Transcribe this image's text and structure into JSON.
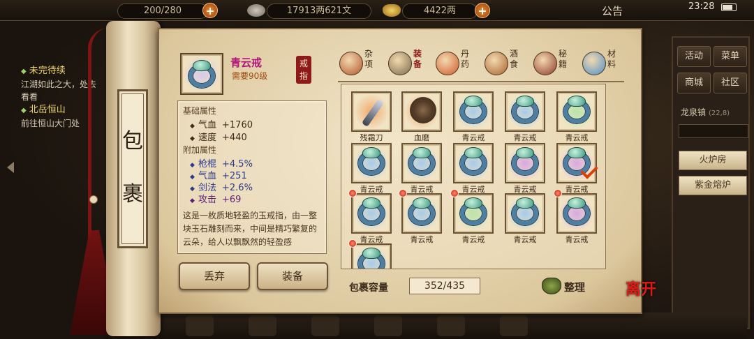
{
  "topbar": {
    "stamina_text": "200/280",
    "copper_text": "17913两621文",
    "silver_text": "4422两",
    "notice_label": "公告",
    "clock": "23:28"
  },
  "quest": {
    "q1_title": "未完待续",
    "q1_desc": "江湖如此之大，处去看看",
    "q2_title": "北岳恒山",
    "q2_desc": "前往恒山大门处"
  },
  "right_menu": {
    "btn_activity": "活动",
    "btn_menu": "菜单",
    "btn_shop": "商城",
    "btn_community": "社区",
    "location": "龙泉镇",
    "coord": "(22,8)",
    "btn_fire_house": "火炉房",
    "btn_purple_furnace": "紫金熔炉"
  },
  "scroll": {
    "ch1": "包",
    "ch2": "裹"
  },
  "selected_item": {
    "name": "青云戒",
    "requirement": "需要90级",
    "type_tag": "戒指",
    "base_title": "基础属性",
    "base_attrs": [
      {
        "name": "气血",
        "value": "+1760"
      },
      {
        "name": "速度",
        "value": "+440"
      }
    ],
    "extra_title": "附加属性",
    "extra_attrs": [
      {
        "name": "枪棍",
        "value": "+4.5%"
      },
      {
        "name": "气血",
        "value": "+251"
      },
      {
        "name": "剑法",
        "value": "+2.6%"
      },
      {
        "name": "攻击",
        "value": "+69"
      }
    ],
    "description": "这是一枚质地轻盈的玉戒指，由一整块玉石雕刻而来，中间是精巧繁复的云朵，给人以飘飘然的轻盈感"
  },
  "actions": {
    "discard": "丢弃",
    "equip": "装备"
  },
  "tabs": [
    {
      "label": "杂项",
      "icon": "jar-icon",
      "color": "#b3552a"
    },
    {
      "label": "装备",
      "icon": "weapons-icon",
      "color": "#7a6a4a"
    },
    {
      "label": "丹药",
      "icon": "pills-icon",
      "color": "#d05a2a"
    },
    {
      "label": "酒食",
      "icon": "wine-food-icon",
      "color": "#a8642c"
    },
    {
      "label": "秘籍",
      "icon": "books-icon",
      "color": "#8e3a2a"
    },
    {
      "label": "材料",
      "icon": "crystal-icon",
      "color": "#4c8fc8"
    }
  ],
  "inventory": [
    {
      "name": "残霜刀",
      "icon": "blade-icon",
      "aura": "#f1a96a",
      "red_dot": false,
      "checked": false
    },
    {
      "name": "血磨",
      "icon": "mace-icon",
      "aura": "#f1a96a",
      "red_dot": false,
      "checked": false
    },
    {
      "name": "青云戒",
      "icon": "ring-icon",
      "aura": "#a8cbe8",
      "red_dot": false,
      "checked": false
    },
    {
      "name": "青云戒",
      "icon": "ring-icon",
      "aura": "#a8cbe8",
      "red_dot": false,
      "checked": false
    },
    {
      "name": "青云戒",
      "icon": "ring-icon",
      "aura": "#b9e3a8",
      "red_dot": false,
      "checked": false
    },
    {
      "name": "青云戒",
      "icon": "ring-icon",
      "aura": "#a8cbe8",
      "red_dot": false,
      "checked": false
    },
    {
      "name": "青云戒",
      "icon": "ring-icon",
      "aura": "#a8cbe8",
      "red_dot": false,
      "checked": false
    },
    {
      "name": "青云戒",
      "icon": "ring-icon",
      "aura": "#a8cbe8",
      "red_dot": false,
      "checked": false
    },
    {
      "name": "青云戒",
      "icon": "ring-icon",
      "aura": "#d7a8e0",
      "red_dot": false,
      "checked": false
    },
    {
      "name": "青云戒",
      "icon": "ring-icon",
      "aura": "#d7a8e0",
      "red_dot": false,
      "checked": true
    },
    {
      "name": "青云戒",
      "icon": "ring-icon",
      "aura": "#a8cbe8",
      "red_dot": true,
      "checked": false
    },
    {
      "name": "青云戒",
      "icon": "ring-icon",
      "aura": "#a8cbe8",
      "red_dot": true,
      "checked": false
    },
    {
      "name": "青云戒",
      "icon": "ring-icon",
      "aura": "#b9e3a8",
      "red_dot": true,
      "checked": false
    },
    {
      "name": "青云戒",
      "icon": "ring-icon",
      "aura": "#a8cbe8",
      "red_dot": false,
      "checked": false
    },
    {
      "name": "青云戒",
      "icon": "ring-icon",
      "aura": "#d7a8e0",
      "red_dot": true,
      "checked": false
    },
    {
      "name": "",
      "icon": "ring-icon",
      "aura": "#a8cbe8",
      "red_dot": true,
      "checked": false
    }
  ],
  "capacity": {
    "label": "包裹容量",
    "value": "352/435"
  },
  "sort_label": "整理",
  "close_label": "离开"
}
